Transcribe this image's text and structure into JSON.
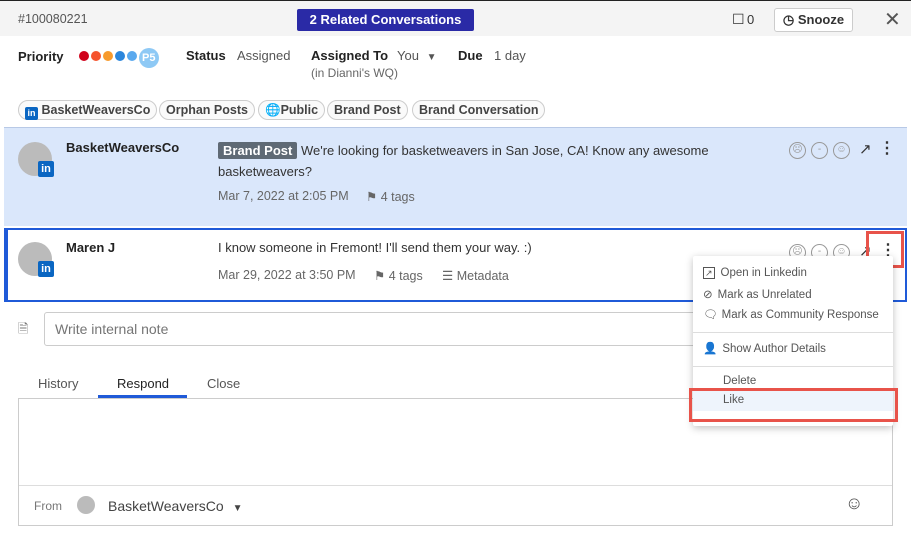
{
  "header": {
    "ticket_id": "#100080221",
    "related_label": "2 Related Conversations",
    "bookmark_count": "0",
    "snooze_label": "Snooze"
  },
  "details": {
    "priority_label": "Priority",
    "priority_badge": "P5",
    "priority_colors": [
      "#d0021b",
      "#f5532d",
      "#f79a2d",
      "#2b86dc",
      "#5aa9ee"
    ],
    "status_label": "Status",
    "status_value": "Assigned",
    "assigned_label": "Assigned To",
    "assigned_value": "You",
    "assigned_sub": "(in Dianni's WQ)",
    "due_label": "Due",
    "due_value": "1 day"
  },
  "chips": [
    "BasketWeaversCo",
    "Orphan Posts",
    "Public",
    "Brand Post",
    "Brand Conversation"
  ],
  "messages": [
    {
      "author": "BasketWeaversCo",
      "badge": "Brand Post",
      "text": "We're looking for basketweavers in San Jose, CA! Know any awesome basketweavers?",
      "date": "Mar 7, 2022 at 2:05 PM",
      "tags": "4 tags"
    },
    {
      "author": "Maren J",
      "text": "I know someone in Fremont! I'll send them your way. :)",
      "date": "Mar 29, 2022 at 3:50 PM",
      "tags": "4 tags",
      "metadata": "Metadata"
    }
  ],
  "note": {
    "placeholder": "Write internal note"
  },
  "tabs": [
    "History",
    "Respond",
    "Close"
  ],
  "active_tab": "Respond",
  "composer": {
    "from_label": "From",
    "from_value": "BasketWeaversCo"
  },
  "menu": {
    "items": [
      "Open in Linkedin",
      "Mark as Unrelated",
      "Mark as Community Response",
      "Show Author Details",
      "Delete",
      "Like"
    ],
    "highlighted": "Like"
  },
  "colors": {
    "accent": "#2a2aa6",
    "selected_border": "#1f5ad8",
    "highlight": "#e8534a"
  }
}
